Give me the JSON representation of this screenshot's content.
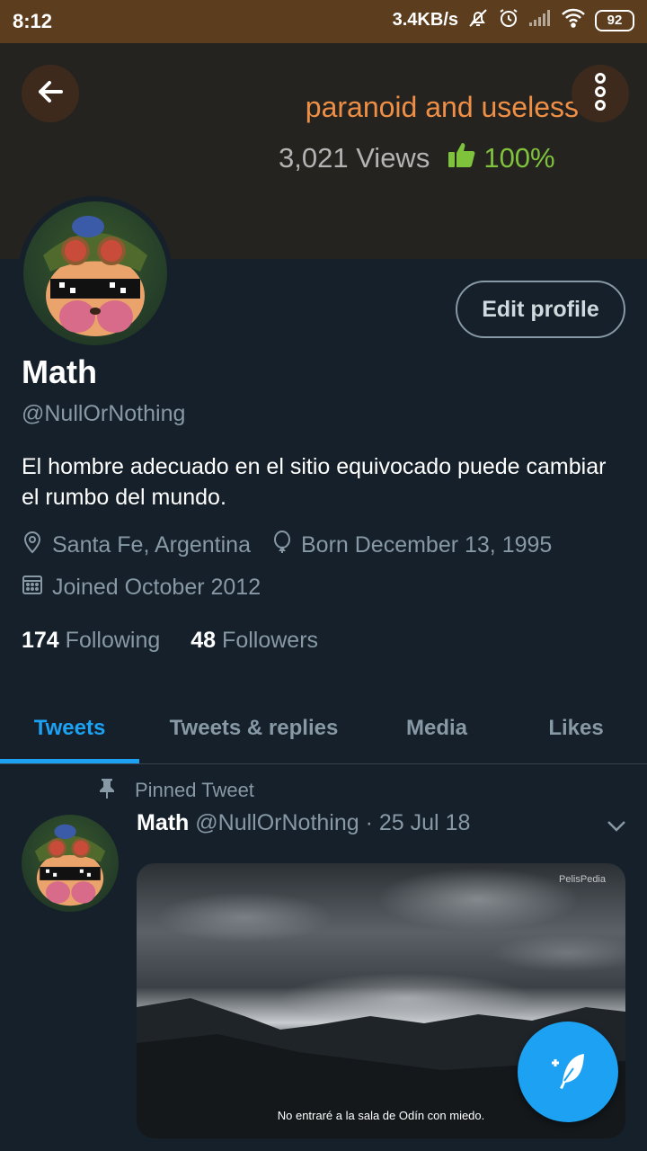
{
  "status_bar": {
    "time": "8:12",
    "network_speed": "3.4KB/s",
    "battery": "92",
    "icons": [
      "bell-off-icon",
      "alarm-icon",
      "signal-icon",
      "wifi-icon",
      "battery-icon"
    ]
  },
  "header": {
    "title": "paranoid and useless",
    "views": "3,021 Views",
    "like_ratio": "100%",
    "title_color": "#ef8f46",
    "like_color": "#7fc23c"
  },
  "profile": {
    "edit_button_label": "Edit profile",
    "name": "Math",
    "handle": "@NullOrNothing",
    "bio": "El hombre adecuado en el sitio equivocado puede cambiar el rumbo del mundo.",
    "location": "Santa Fe, Argentina",
    "birthday": "Born December 13, 1995",
    "joined": "Joined October 2012",
    "following_count": "174",
    "following_label": "Following",
    "followers_count": "48",
    "followers_label": "Followers"
  },
  "tabs": [
    {
      "label": "Tweets",
      "active": true
    },
    {
      "label": "Tweets & replies",
      "active": false
    },
    {
      "label": "Media",
      "active": false
    },
    {
      "label": "Likes",
      "active": false
    }
  ],
  "pinned_tweet": {
    "pinned_label": "Pinned Tweet",
    "author_name": "Math",
    "author_handle": "@NullOrNothing",
    "date": "· 25 Jul 18",
    "media_watermark": "PelisPedia",
    "media_subtitle": "No entraré a la sala de Odín con miedo."
  },
  "accent_color": "#1da1f2"
}
